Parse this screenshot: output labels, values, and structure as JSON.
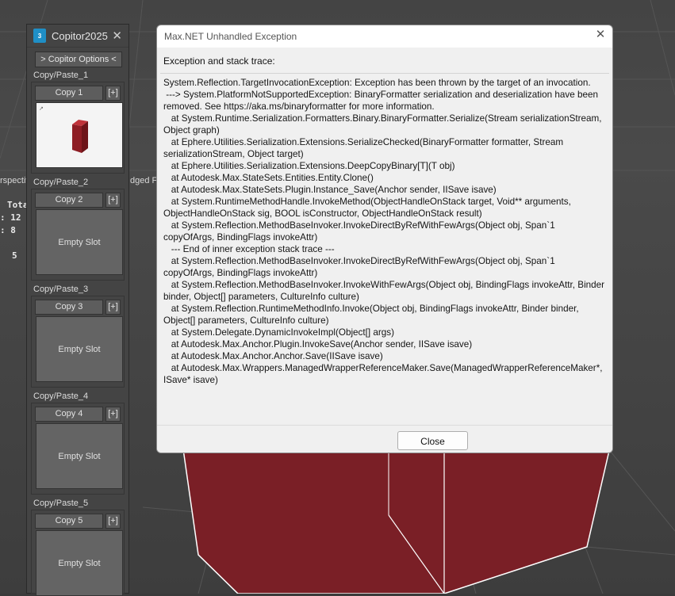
{
  "viewport": {
    "label": "rspectiv",
    "edged_label": "dged Fa",
    "stats_total": "Tota",
    "stats_1": ": 12",
    "stats_2": ": 8",
    "stats_3": "5"
  },
  "copitor": {
    "title": "Copitor2025",
    "logo": "3",
    "options_label": "> Copitor Options <",
    "plus_label": "[+]",
    "slots": [
      {
        "group": "Copy/Paste_1",
        "copy": "Copy 1",
        "content": ""
      },
      {
        "group": "Copy/Paste_2",
        "copy": "Copy 2",
        "content": "Empty Slot"
      },
      {
        "group": "Copy/Paste_3",
        "copy": "Copy 3",
        "content": "Empty Slot"
      },
      {
        "group": "Copy/Paste_4",
        "copy": "Copy 4",
        "content": "Empty Slot"
      },
      {
        "group": "Copy/Paste_5",
        "copy": "Copy 5",
        "content": "Empty Slot"
      }
    ]
  },
  "dialog": {
    "title": "Max.NET Unhandled Exception",
    "label": "Exception and stack trace:",
    "trace": "System.Reflection.TargetInvocationException: Exception has been thrown by the target of an invocation.\n ---> System.PlatformNotSupportedException: BinaryFormatter serialization and deserialization have been removed. See https://aka.ms/binaryformatter for more information.\n   at System.Runtime.Serialization.Formatters.Binary.BinaryFormatter.Serialize(Stream serializationStream, Object graph)\n   at Ephere.Utilities.Serialization.Extensions.SerializeChecked(BinaryFormatter formatter, Stream serializationStream, Object target)\n   at Ephere.Utilities.Serialization.Extensions.DeepCopyBinary[T](T obj)\n   at Autodesk.Max.StateSets.Entities.Entity.Clone()\n   at Autodesk.Max.StateSets.Plugin.Instance_Save(Anchor sender, IISave isave)\n   at System.RuntimeMethodHandle.InvokeMethod(ObjectHandleOnStack target, Void** arguments, ObjectHandleOnStack sig, BOOL isConstructor, ObjectHandleOnStack result)\n   at System.Reflection.MethodBaseInvoker.InvokeDirectByRefWithFewArgs(Object obj, Span`1 copyOfArgs, BindingFlags invokeAttr)\n   --- End of inner exception stack trace ---\n   at System.Reflection.MethodBaseInvoker.InvokeDirectByRefWithFewArgs(Object obj, Span`1 copyOfArgs, BindingFlags invokeAttr)\n   at System.Reflection.MethodBaseInvoker.InvokeWithFewArgs(Object obj, BindingFlags invokeAttr, Binder binder, Object[] parameters, CultureInfo culture)\n   at System.Reflection.RuntimeMethodInfo.Invoke(Object obj, BindingFlags invokeAttr, Binder binder, Object[] parameters, CultureInfo culture)\n   at System.Delegate.DynamicInvokeImpl(Object[] args)\n   at Autodesk.Max.Anchor.Plugin.InvokeSave(Anchor sender, IISave isave)\n   at Autodesk.Max.Anchor.Anchor.Save(IISave isave)\n   at Autodesk.Max.Wrappers.ManagedWrapperReferenceMaker.Save(ManagedWrapperReferenceMaker*, ISave* isave)",
    "close_label": "Close"
  },
  "colors": {
    "object_red": "#7a1f26",
    "panel_bg": "#444444",
    "dialog_bg": "#f0f0f0"
  }
}
